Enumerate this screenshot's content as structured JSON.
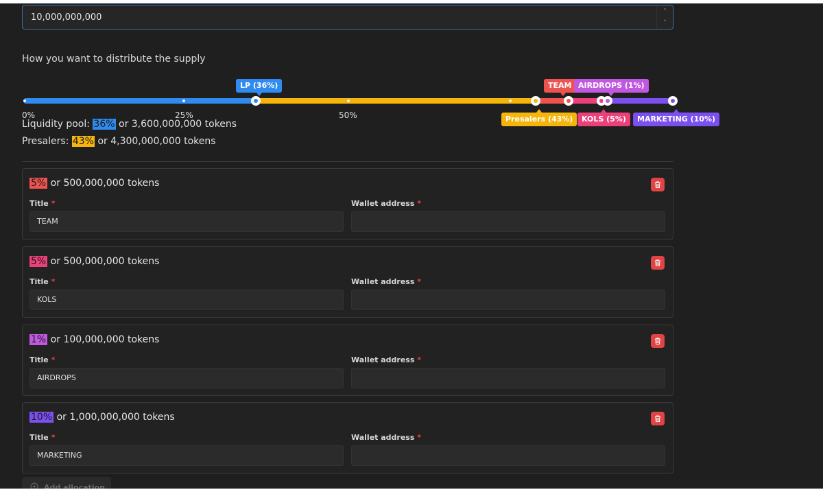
{
  "supply": {
    "value": "10,000,000,000"
  },
  "distribution": {
    "label": "How you want to distribute the supply",
    "ticks": [
      "0%",
      "25%",
      "50%"
    ],
    "pills": {
      "lp": "LP (36%)",
      "team": "TEAM (",
      "airdrops": "AIRDROPS (1%)",
      "presalers": "Presalers (43%)",
      "kols": "KOLS (5%)",
      "marketing": "MARKETING (10%)"
    },
    "summary": {
      "liquidity_label": "Liquidity pool:",
      "liquidity_pct": "36%",
      "liquidity_tokens": "or 3,600,000,000 tokens",
      "presalers_label": "Presalers:",
      "presalers_pct": "43%",
      "presalers_tokens": "or 4,300,000,000 tokens"
    }
  },
  "allocations": [
    {
      "pct": "5%",
      "tokens": "or 500,000,000 tokens",
      "title": "TEAM",
      "color": "#ef5350"
    },
    {
      "pct": "5%",
      "tokens": "or 500,000,000 tokens",
      "title": "KOLS",
      "color": "#ec407a"
    },
    {
      "pct": "1%",
      "tokens": "or 100,000,000 tokens",
      "title": "AIRDROPS",
      "color": "#c159e0"
    },
    {
      "pct": "10%",
      "tokens": "or 1,000,000,000 tokens",
      "title": "MARKETING",
      "color": "#7b50f0"
    }
  ],
  "fields": {
    "title_label": "Title",
    "wallet_label": "Wallet address",
    "required_mark": "*"
  },
  "add_allocation_label": "Add allocation",
  "colors": {
    "lp": "#2f8bf0",
    "presalers": "#f5b50c",
    "team": "#ef5350",
    "kols": "#ec407a",
    "airdrops": "#c159e0",
    "marketing": "#7b50f0"
  }
}
